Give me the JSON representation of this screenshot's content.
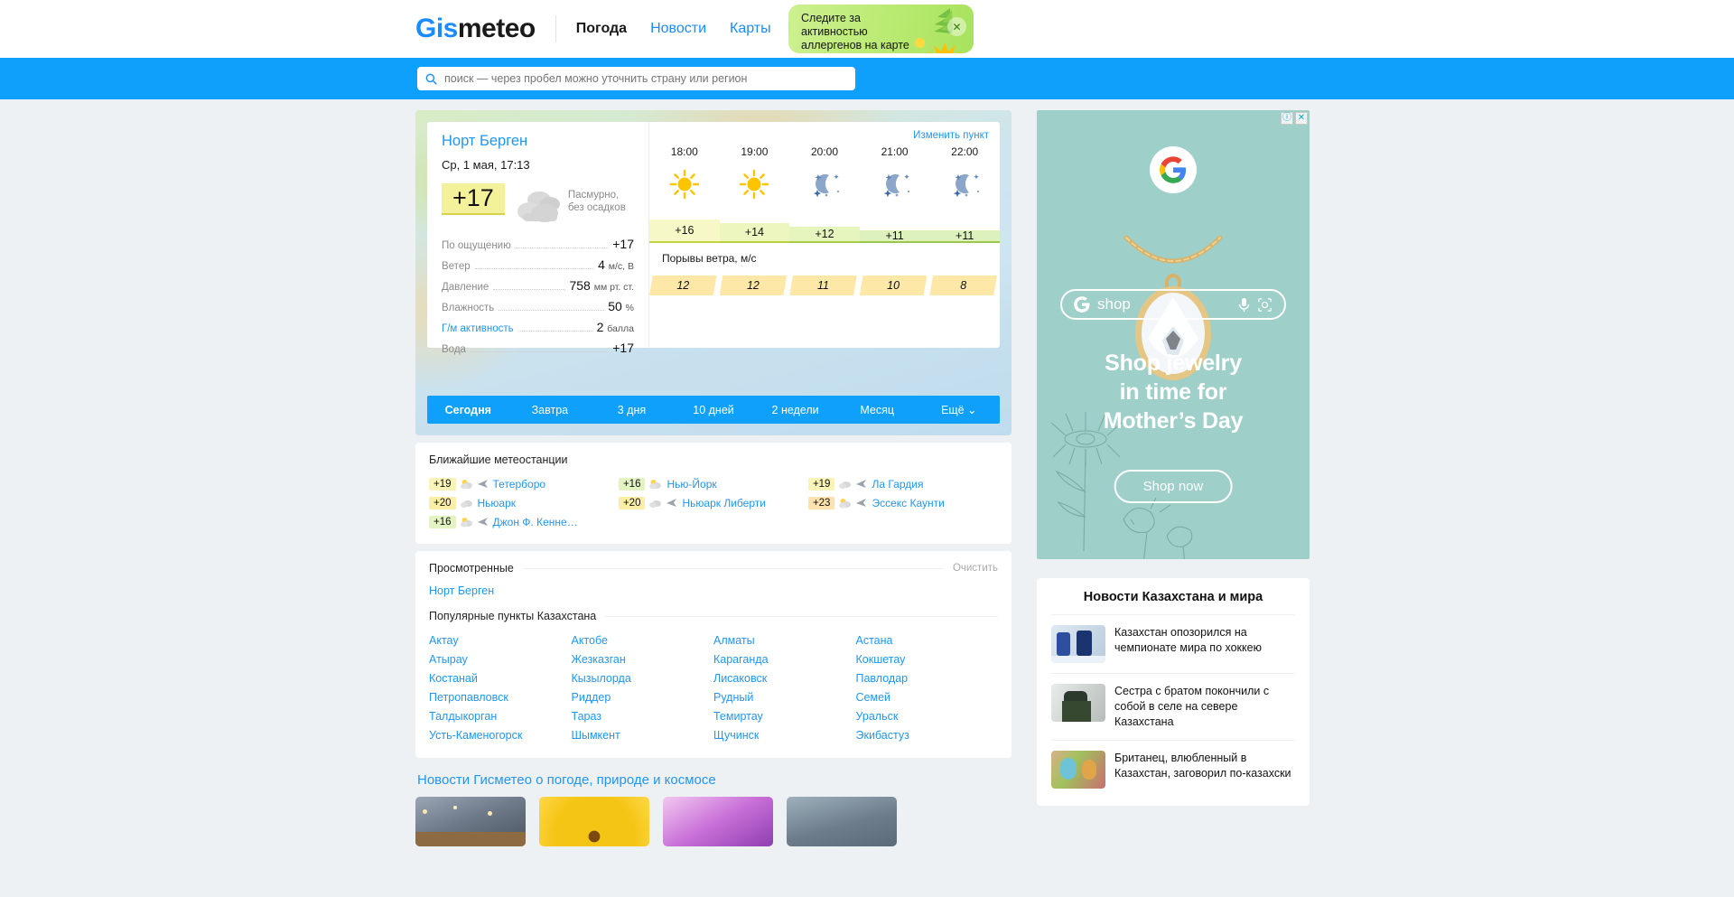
{
  "header": {
    "logo_gis": "Gis",
    "logo_meteo": "meteo",
    "nav": [
      {
        "label": "Погода",
        "active": true
      },
      {
        "label": "Новости",
        "active": false
      },
      {
        "label": "Карты",
        "active": false
      }
    ],
    "tooltip": {
      "text": "Следите за активностью аллергенов на карте",
      "close": "✕"
    }
  },
  "search": {
    "placeholder": "поиск — через пробел можно уточнить страну или регион",
    "value": ""
  },
  "weather_card": {
    "city": "Норт Берген",
    "date": "Ср, 1 мая, 17:13",
    "change_point": "Изменить пункт",
    "temperature": "+17",
    "condition": "Пасмурно, без осадков",
    "details": [
      {
        "label": "По ощущению",
        "value": "+17",
        "unit": "",
        "link": false
      },
      {
        "label": "Ветер",
        "value": "4",
        "unit": "м/с, В",
        "link": false
      },
      {
        "label": "Давление",
        "value": "758",
        "unit": "мм рт. ст.",
        "link": false
      },
      {
        "label": "Влажность",
        "value": "50",
        "unit": "%",
        "link": false
      },
      {
        "label": "Г/м активность",
        "value": "2",
        "unit": "балла",
        "link": true
      },
      {
        "label": "Вода",
        "value": "+17",
        "unit": "",
        "link": false
      }
    ],
    "hours": [
      {
        "time": "18:00",
        "icon": "sun-icon",
        "temp": "+16",
        "gust": "12"
      },
      {
        "time": "19:00",
        "icon": "sun-icon",
        "temp": "+14",
        "gust": "12"
      },
      {
        "time": "20:00",
        "icon": "moon-stars-icon",
        "temp": "+12",
        "gust": "11"
      },
      {
        "time": "21:00",
        "icon": "moon-stars-icon",
        "temp": "+11",
        "gust": "10"
      },
      {
        "time": "22:00",
        "icon": "moon-stars-icon",
        "temp": "+11",
        "gust": "8"
      }
    ],
    "gust_title": "Порывы ветра, м/с",
    "tabs": [
      {
        "label": "Сегодня",
        "active": true
      },
      {
        "label": "Завтра",
        "active": false
      },
      {
        "label": "3 дня",
        "active": false
      },
      {
        "label": "10 дней",
        "active": false
      },
      {
        "label": "2 недели",
        "active": false
      },
      {
        "label": "Месяц",
        "active": false
      },
      {
        "label": "Ещё",
        "active": false
      }
    ]
  },
  "stations": {
    "title": "Ближайшие метеостанции",
    "items": [
      {
        "temp": "+19",
        "name": "Тетерборо",
        "icon": "partly-cloudy-icon",
        "plane": true,
        "color": "#fbf4b8"
      },
      {
        "temp": "+16",
        "name": "Нью-Йорк",
        "icon": "partly-cloudy-icon",
        "plane": false,
        "color": "#e4f3c2"
      },
      {
        "temp": "+19",
        "name": "Ла Гардия",
        "icon": "cloudy-icon",
        "plane": true,
        "color": "#fbf4b8"
      },
      {
        "temp": "+20",
        "name": "Ньюарк",
        "icon": "cloudy-icon",
        "plane": false,
        "color": "#fbefa8"
      },
      {
        "temp": "+20",
        "name": "Ньюарк Либерти",
        "icon": "cloudy-icon",
        "plane": true,
        "color": "#fbefa8"
      },
      {
        "temp": "+23",
        "name": "Эссекс Каунти",
        "icon": "partly-cloudy-icon",
        "plane": true,
        "color": "#fde2b0"
      },
      {
        "temp": "+16",
        "name": "Джон Ф. Кенне…",
        "icon": "partly-cloudy-icon",
        "plane": true,
        "color": "#e4f3c2"
      }
    ]
  },
  "viewed": {
    "title": "Просмотренные",
    "clear": "Очистить",
    "items": [
      "Норт Берген"
    ]
  },
  "popular": {
    "title": "Популярные пункты Казахстана",
    "cities": [
      "Актау",
      "Актобе",
      "Алматы",
      "Астана",
      "Атырау",
      "Жезказган",
      "Караганда",
      "Кокшетау",
      "Костанай",
      "Кызылорда",
      "Лисаковск",
      "Павлодар",
      "Петропавловск",
      "Риддер",
      "Рудный",
      "Семей",
      "Талдыкорган",
      "Тараз",
      "Темиртау",
      "Уральск",
      "Усть-Каменогорск",
      "Шымкент",
      "Щучинск",
      "Экибастуз"
    ]
  },
  "bottom_news": {
    "title": "Новости Гисметео о погоде, природе и космосе",
    "thumbs": [
      "city-night-thumb",
      "yellow-flower-thumb",
      "purple-blossom-thumb",
      "storm-cloud-thumb"
    ]
  },
  "ad": {
    "brand": "shop",
    "headline": "Shop jewelry\nin time for\nMother’s Day",
    "headline_lines": [
      "Shop jewelry",
      "in time for",
      "Mother’s Day"
    ],
    "button": "Shop now",
    "info": "ⓘ",
    "close": "✕",
    "bg_color": "#9fcfc9"
  },
  "sidebar_news": {
    "title": "Новости Казахстана и мира",
    "items": [
      {
        "text": "Казахстан опозорился на чемпионате мира по хоккею",
        "thumb": "hockey-thumb"
      },
      {
        "text": "Сестра с братом покончили с собой в селе на севере Казахстана",
        "thumb": "police-thumb"
      },
      {
        "text": "Британец, влюбленный в Казахстан, заговорил по-казахски",
        "thumb": "face-paint-thumb"
      }
    ]
  }
}
